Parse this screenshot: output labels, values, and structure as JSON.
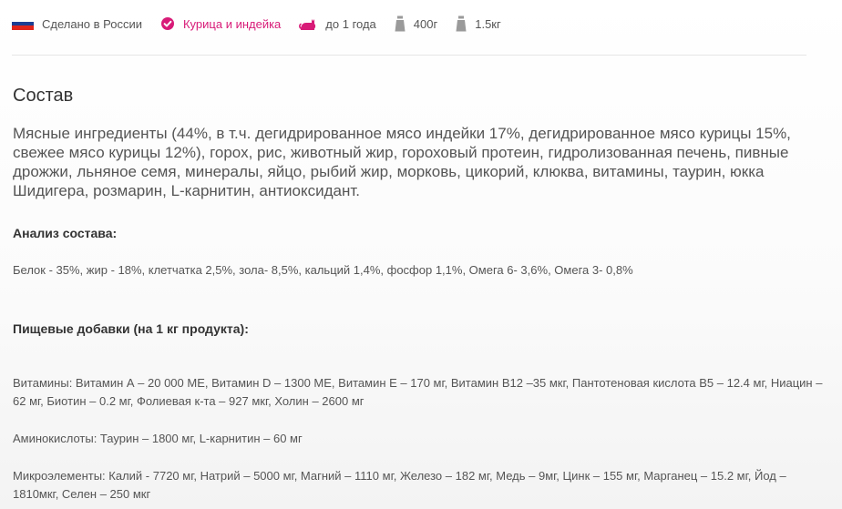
{
  "attributes": {
    "country": "Сделано в России",
    "flavor": "Курица и индейка",
    "age": "до 1 года",
    "weight_small": "400г",
    "weight_large": "1.5кг"
  },
  "colors": {
    "accent": "#d81b78",
    "flag_white": "#ffffff",
    "flag_blue": "#1c3f94",
    "flag_red": "#e1251b",
    "icon_gray": "#9a9a9a"
  },
  "icons": {
    "country": "russia-flag-icon",
    "flavor": "check-circle-icon",
    "age": "cat-icon",
    "weight_small": "bag-icon",
    "weight_large": "bag-icon"
  },
  "composition": {
    "title": "Состав",
    "text": "Мясные ингредиенты (44%, в т.ч. дегидрированное мясо индейки 17%, дегидрированное мясо курицы 15%, свежее мясо курицы 12%), горох, рис, животный жир, гороховый протеин, гидролизованная печень, пивные дрожжи, льняное семя, минералы, яйцо, рыбий жир, морковь, цикорий, клюква, витамины, таурин, юкка Шидигера, розмарин, L-карнитин, антиоксидант."
  },
  "analysis": {
    "title": "Анализ состава:",
    "text": "Белок - 35%, жир - 18%, клетчатка 2,5%, зола- 8,5%, кальций 1,4%, фосфор 1,1%, Омега 6- 3,6%, Омега 3- 0,8%"
  },
  "additives": {
    "title": "Пищевые добавки (на 1 кг продукта):",
    "vitamins": "Витамины: Витамин А – 20 000 МЕ, Витамин D – 1300 МЕ, Витамин Е – 170 мг, Витамин B12 –35 мкг, Пантотеновая кислота В5 – 12.4 мг, Ниацин – 62 мг, Биотин – 0.2 мг, Фолиевая к-та – 927 мкг, Холин – 2600 мг",
    "amino_acids": "Аминокислоты: Таурин – 1800 мг, L-карнитин – 60 мг",
    "microelements": "Микроэлементы: Калий - 7720 мг, Натрий – 5000 мг, Магний – 1110 мг, Железо – 182 мг, Медь – 9мг, Цинк – 155 мг, Марганец – 15.2 мг, Йод – 1810мкг, Селен – 250 мкг"
  }
}
